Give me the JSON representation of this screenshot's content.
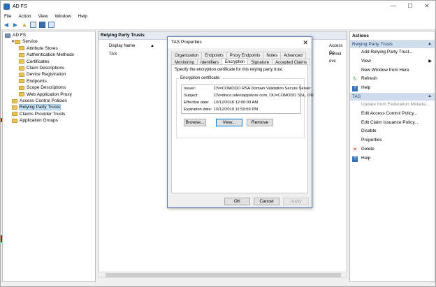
{
  "app": {
    "title": "AD FS"
  },
  "menu": [
    "File",
    "Action",
    "View",
    "Window",
    "Help"
  ],
  "window_controls": {
    "minimize": "—",
    "maximize": "☐",
    "close": "✕"
  },
  "tree": [
    {
      "label": "AD FS",
      "level": 0,
      "selected": false
    },
    {
      "label": "Service",
      "level": 1,
      "selected": false
    },
    {
      "label": "Attribute Stores",
      "level": 2,
      "selected": false
    },
    {
      "label": "Authentication Methods",
      "level": 2,
      "selected": false
    },
    {
      "label": "Certificates",
      "level": 2,
      "selected": false
    },
    {
      "label": "Claim Descriptions",
      "level": 2,
      "selected": false
    },
    {
      "label": "Device Registration",
      "level": 2,
      "selected": false
    },
    {
      "label": "Endpoints",
      "level": 2,
      "selected": false
    },
    {
      "label": "Scope Descriptions",
      "level": 2,
      "selected": false
    },
    {
      "label": "Web Application Proxy",
      "level": 2,
      "selected": false
    },
    {
      "label": "Access Control Policies",
      "level": 1,
      "selected": false
    },
    {
      "label": "Relying Party Trusts",
      "level": 1,
      "selected": true
    },
    {
      "label": "Claims Provider Trusts",
      "level": 1,
      "selected": false
    },
    {
      "label": "Application Groups",
      "level": 1,
      "selected": false
    }
  ],
  "center": {
    "header": "Relying Party Trusts",
    "col_display_name": "Display Name",
    "col_access": "Access Co",
    "row_name": "TAS",
    "row_access": "Permit eve"
  },
  "actions": {
    "header": "Actions",
    "section1": "Relying Party Trusts",
    "items1": [
      {
        "label": "Add Relying Party Trust...",
        "icon": "none",
        "disabled": false
      },
      {
        "label": "View",
        "icon": "none",
        "disabled": false,
        "submenu": true
      },
      {
        "label": "New Window from Here",
        "icon": "none",
        "disabled": false
      },
      {
        "label": "Refresh",
        "icon": "refresh-icon",
        "disabled": false
      },
      {
        "label": "Help",
        "icon": "help-icon",
        "disabled": false
      }
    ],
    "section2": "TAS",
    "items2": [
      {
        "label": "Update from Federation Metada...",
        "icon": "none",
        "disabled": true
      },
      {
        "label": "Edit Access Control Policy...",
        "icon": "none",
        "disabled": false
      },
      {
        "label": "Edit Claim Issuance Policy...",
        "icon": "none",
        "disabled": false
      },
      {
        "label": "Disable",
        "icon": "none",
        "disabled": false
      },
      {
        "label": "Properties",
        "icon": "none",
        "disabled": false
      },
      {
        "label": "Delete",
        "icon": "delete-icon",
        "disabled": false
      },
      {
        "label": "Help",
        "icon": "help-icon",
        "disabled": false
      }
    ]
  },
  "dialog": {
    "title": "TAS Properties",
    "tabs_row1": [
      "Organization",
      "Endpoints",
      "Proxy Endpoints",
      "Notes",
      "Advanced"
    ],
    "tabs_row2": [
      "Monitoring",
      "Identifiers",
      "Encryption",
      "Signature",
      "Accepted Claims"
    ],
    "active_tab": "Encryption",
    "instruction": "Specify the encryption certificate for this relying party trust.",
    "group_label": "Encryption certificate:",
    "cert": {
      "issuer_label": "Issuer:",
      "issuer": "CN=COMODO RSA Domain Validation Secure Server",
      "subject_label": "Subject:",
      "subject": "CN=disco.talentappstore.com, OU=COMODO SSL, OU",
      "effective_label": "Effective date:",
      "effective": "10/12/2016 12:00:00 AM",
      "expiration_label": "Expiration date:",
      "expiration": "10/12/2019 11:59:59 PM"
    },
    "btn_browse": "Browse...",
    "btn_view": "View...",
    "btn_remove": "Remove",
    "btn_ok": "OK",
    "btn_cancel": "Cancel",
    "btn_apply": "Apply"
  }
}
